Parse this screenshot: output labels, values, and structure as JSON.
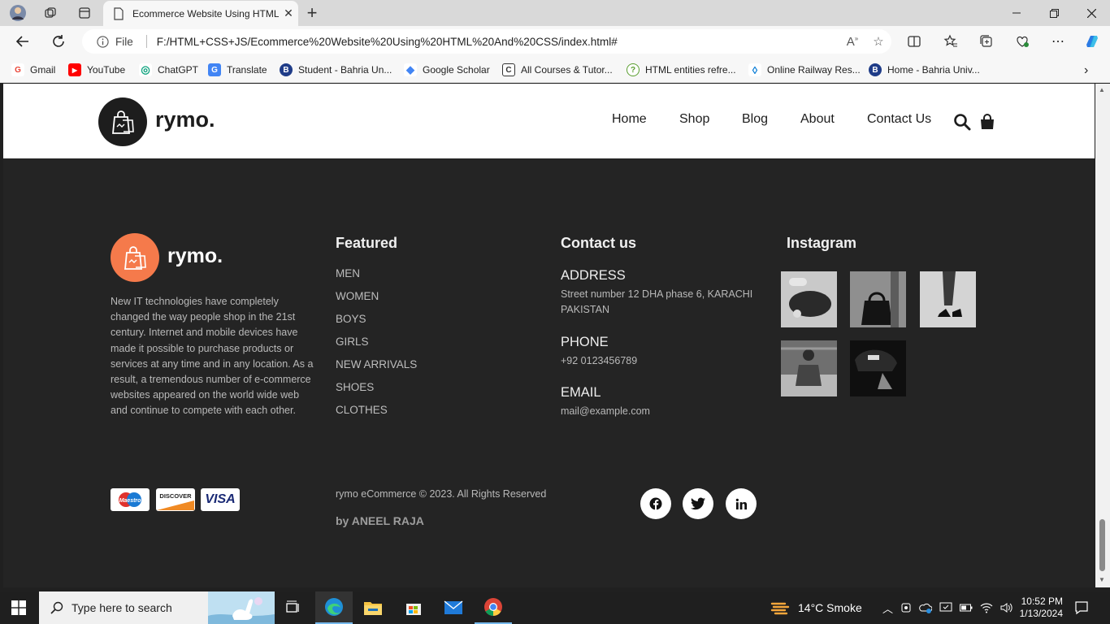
{
  "browser": {
    "tab_title": "Ecommerce Website Using HTML",
    "tab_close": "✕",
    "new_tab": "+",
    "address": {
      "file_label": "File",
      "url": "F:/HTML+CSS+JS/Ecommerce%20Website%20Using%20HTML%20And%20CSS/index.html#"
    },
    "bookmarks": [
      {
        "label": "Gmail",
        "icon": "gmail-icon",
        "color": "#ea4335",
        "glyph": "G"
      },
      {
        "label": "YouTube",
        "icon": "youtube-icon",
        "color": "#ff0000",
        "glyph": "▶"
      },
      {
        "label": "ChatGPT",
        "icon": "chatgpt-icon",
        "color": "#10a37f",
        "glyph": "◎"
      },
      {
        "label": "Translate",
        "icon": "translate-icon",
        "color": "#4285f4",
        "glyph": "G"
      },
      {
        "label": "Student - Bahria Un...",
        "icon": "bahria-icon",
        "color": "#1f3c88",
        "glyph": "B"
      },
      {
        "label": "Google Scholar",
        "icon": "scholar-icon",
        "color": "#4285f4",
        "glyph": "◆"
      },
      {
        "label": "All Courses & Tutor...",
        "icon": "courses-icon",
        "color": "#333333",
        "glyph": "C"
      },
      {
        "label": "HTML entities refre...",
        "icon": "help-icon",
        "color": "#5a9e2f",
        "glyph": "?"
      },
      {
        "label": "Online Railway Res...",
        "icon": "railway-icon",
        "color": "#0078d4",
        "glyph": "◊"
      },
      {
        "label": "Home - Bahria Univ...",
        "icon": "bahria-home-icon",
        "color": "#1f3c88",
        "glyph": "B"
      }
    ]
  },
  "site": {
    "brand": "rymo.",
    "menu": [
      "Home",
      "Shop",
      "Blog",
      "About",
      "Contact Us"
    ],
    "footer": {
      "brand": "rymo.",
      "about": "New IT technologies have completely changed the way people shop in the 21st century. Internet and mobile devices have made it possible to purchase products or services at any time and in any location. As a result, a tremendous number of e-commerce websites appeared on the world wide web and continue to compete with each other.",
      "featured_title": "Featured",
      "featured": [
        "MEN",
        "WOMEN",
        "BOYS",
        "GIRLS",
        "NEW ARRIVALS",
        "SHOES",
        "CLOTHES"
      ],
      "contact_title": "Contact us",
      "address_label": "ADDRESS",
      "address": "Street number 12 DHA phase 6, KARACHI PAKISTAN",
      "phone_label": "PHONE",
      "phone": "+92 0123456789",
      "email_label": "EMAIL",
      "email": "mail@example.com",
      "instagram_title": "Instagram",
      "payments": [
        "Maestro",
        "DISCOVER",
        "VISA"
      ],
      "copyright": "rymo eCommerce © 2023. All Rights Reserved",
      "byline": "by ANEEL RAJA",
      "social": [
        "facebook-icon",
        "twitter-icon",
        "linkedin-icon"
      ]
    },
    "accent": "#f57a4b",
    "footer_bg": "#242424"
  },
  "taskbar": {
    "search_placeholder": "Type here to search",
    "weather": "14°C  Smoke",
    "time": "10:52 PM",
    "date": "1/13/2024"
  }
}
